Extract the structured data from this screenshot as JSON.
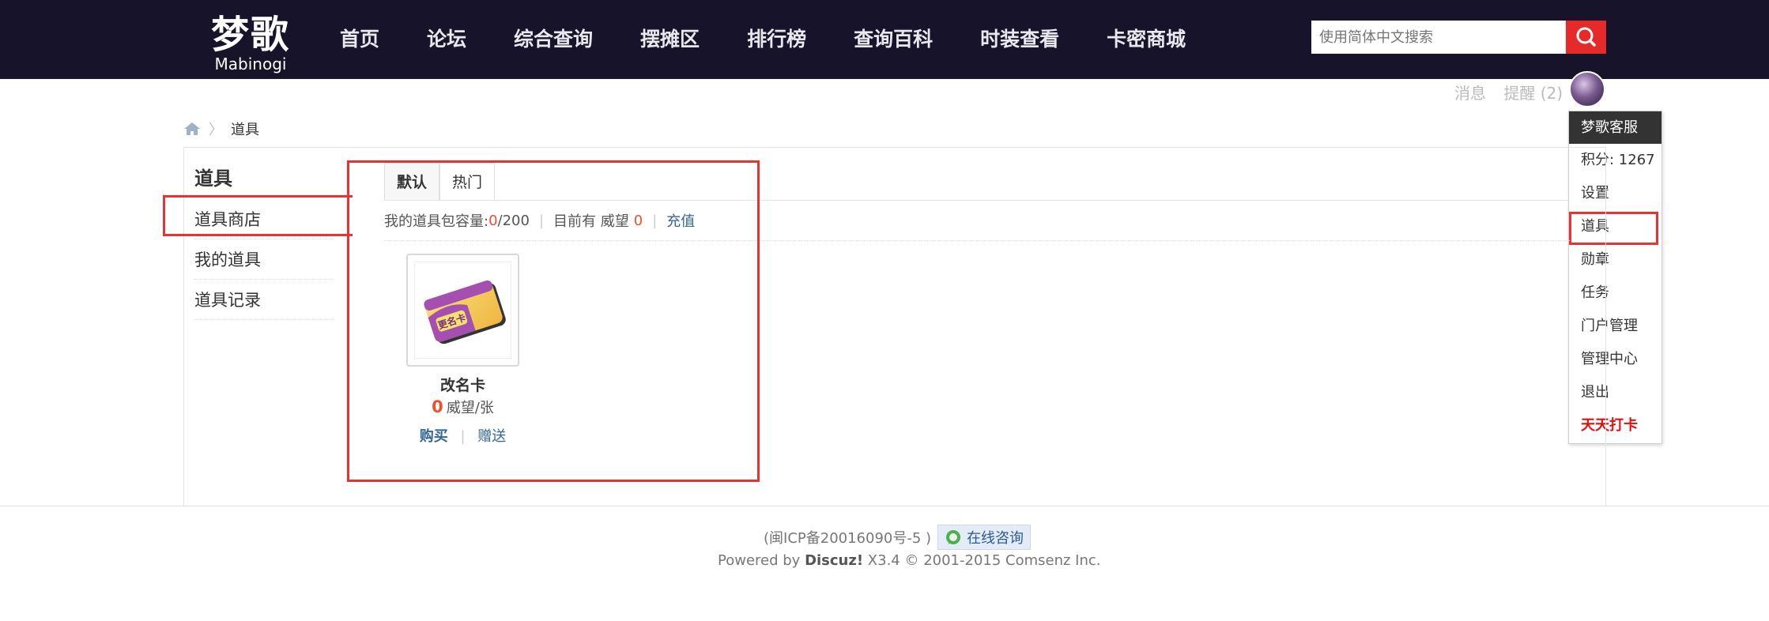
{
  "header": {
    "logo_cn": "梦歌",
    "logo_en": "Mabinogi",
    "nav": [
      "首页",
      "论坛",
      "综合查询",
      "摆摊区",
      "排行榜",
      "查询百科",
      "时装查看",
      "卡密商城"
    ],
    "search_placeholder": "使用简体中文搜索"
  },
  "user": {
    "messages": "消息",
    "reminders": "提醒 (2)",
    "dropdown": {
      "head": "梦歌客服",
      "items": [
        "积分: 1267",
        "设置",
        "道具",
        "勋章",
        "任务",
        "门户管理",
        "管理中心",
        "退出",
        "天天打卡"
      ]
    }
  },
  "breadcrumb": {
    "current": "道具"
  },
  "sidebar": {
    "title": "道具",
    "items": [
      "道具商店",
      "我的道具",
      "道具记录"
    ]
  },
  "tabs": [
    "默认",
    "热门"
  ],
  "capacity": {
    "label": "我的道具包容量:",
    "used": "0",
    "total": "/200",
    "prestige_label": "目前有 威望",
    "prestige_value": "0",
    "recharge": "充值"
  },
  "item": {
    "name": "改名卡",
    "price": "0",
    "unit": "威望/张",
    "buy": "购买",
    "gift": "赠送",
    "card_text": "更名卡"
  },
  "footer": {
    "icp": "(闽ICP备20016090号-5 )",
    "consult": "在线咨询",
    "powered_prefix": "Powered by",
    "powered_brand": "Discuz!",
    "powered_suffix": " X3.4 © 2001-2015 Comsenz Inc."
  },
  "colors": {
    "topbar": "#16132a",
    "accent_red": "#e53434",
    "link": "#336699",
    "search_button": "#e62a2a"
  }
}
